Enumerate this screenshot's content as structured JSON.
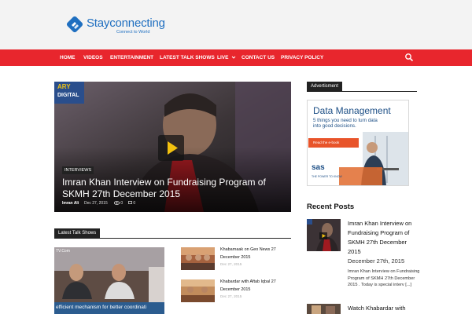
{
  "site": {
    "logo_name": "Stayconnecting",
    "logo_tagline": "Connect to World"
  },
  "nav": {
    "items": [
      {
        "label": "HOME"
      },
      {
        "label": "VIDEOS"
      },
      {
        "label": "ENTERTAINMENT"
      },
      {
        "label": "LATEST TALK SHOWS"
      },
      {
        "label": "LIVE"
      },
      {
        "label": "CONTACT US"
      },
      {
        "label": "PRIVACY POLICY"
      }
    ],
    "search_icon": "search-icon"
  },
  "hero": {
    "image_overlay_text_1": "ARY",
    "image_overlay_text_2": "DIGITAL",
    "category": "INTERVIEWS",
    "title": "Imran Khan Interview on Fundraising Program of SKMH 27th December 2015",
    "author": "Imran Ali",
    "date": "Dec 27, 2015",
    "views": "0",
    "comments": "0"
  },
  "sidebar": {
    "ad_label": "Advertisment",
    "ad": {
      "headline": "Data Management",
      "subtext": "5 things you need to turn data into good decisions.",
      "cta": "Read the e-book",
      "brand": "sas",
      "brand_tagline": "THE POWER TO KNOW"
    },
    "recent_title": "Recent Posts",
    "recent_posts": [
      {
        "title": "Imran Khan Interview on Fundraising Program of SKMH 27th December 2015",
        "date": "December 27th, 2015",
        "excerpt": "Imran Khan Interview on Fundraising Program of SKMH 27th December 2015 . Today is special interv [...]"
      },
      {
        "title": "Watch Khabardar with",
        "date": "",
        "excerpt": ""
      }
    ]
  },
  "latest_talk_shows": {
    "label": "Latest Talk Shows",
    "image_watermark": "TV.Com",
    "image_caption": "efficient mechanism for better coordinati",
    "items": [
      {
        "title": "Khabarnaak on Geo News 27 December 2015",
        "date": "Dec 27, 2015"
      },
      {
        "title": "Khabardar with Aftab Iqbal 27 December 2015",
        "date": "Dec 27, 2015"
      }
    ]
  },
  "colors": {
    "nav_bg": "#e8262d",
    "logo_blue": "#1f6fc0",
    "block_title_bg": "#222222",
    "ad_orange": "#e8542a"
  }
}
